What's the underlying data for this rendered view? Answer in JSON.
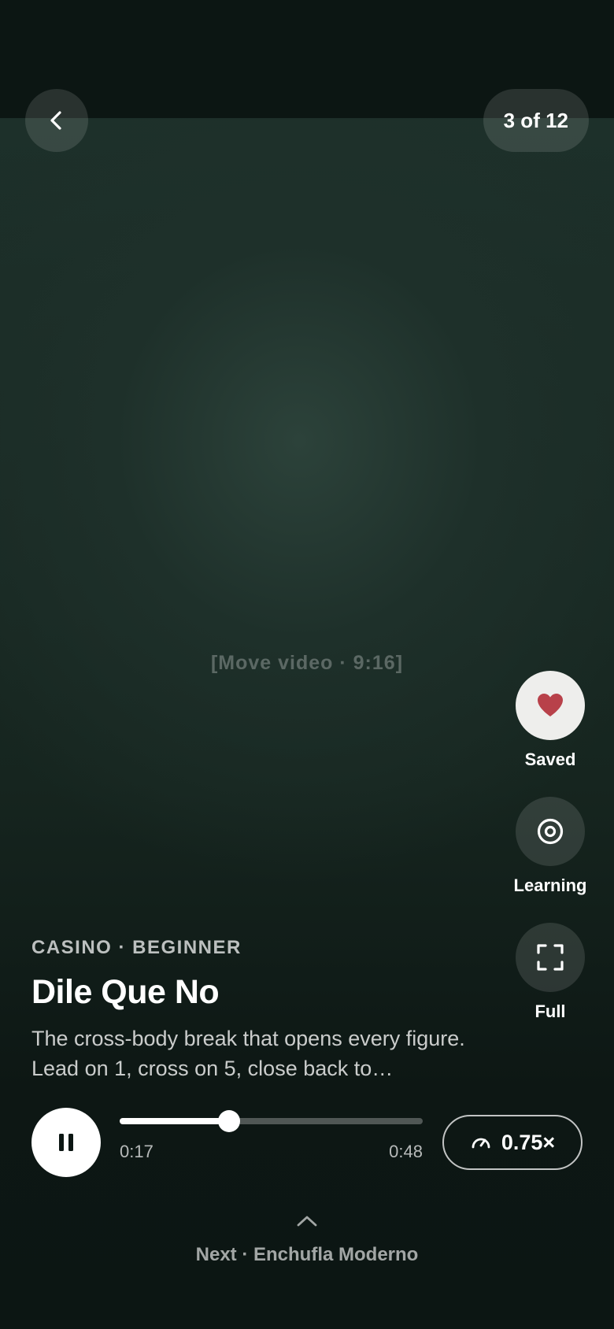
{
  "header": {
    "counter": "3 of 12"
  },
  "video": {
    "placeholder": "[Move video · 9:16]"
  },
  "actions": {
    "saved": {
      "label": "Saved",
      "icon": "heart-icon",
      "color": "#b8414a"
    },
    "learning": {
      "label": "Learning",
      "icon": "target-icon"
    },
    "full": {
      "label": "Full",
      "icon": "fullscreen-icon"
    }
  },
  "move": {
    "category": "CASINO · BEGINNER",
    "title": "Dile Que No",
    "description": "The cross-body break that opens every figure. Lead on 1, cross on 5, close back to…"
  },
  "player": {
    "current_time": "0:17",
    "duration": "0:48",
    "progress": 0.36,
    "speed": "0.75×"
  },
  "next": {
    "label": "Next · Enchufla Moderno"
  }
}
